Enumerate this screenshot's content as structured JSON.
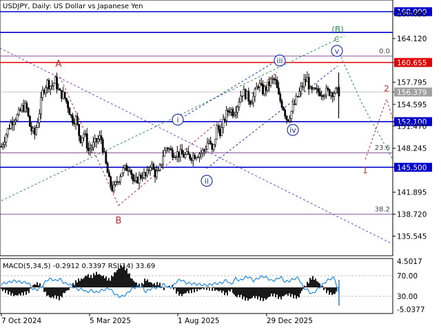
{
  "window_title": "USDJPY, Daily:  US Dollar vs Japanese Yen",
  "chart_data": [
    {
      "type": "candlestick",
      "symbol": "USDJPY",
      "timeframe": "Daily",
      "ylim": [
        133.8,
        170.0
      ],
      "xlim": [
        "2024-10-07",
        "2026-03-12"
      ],
      "y_ticks": [
        "168.000",
        "167.695",
        "164.120",
        "160.655",
        "157.795",
        "156.379",
        "154.595",
        "152.100",
        "151.470",
        "148.245",
        "145.500",
        "141.895",
        "138.720",
        "135.545"
      ],
      "x_ticks": [
        "7 Oct 2024",
        "5 Mar 2025",
        "1 Aug 2025",
        "29 Dec 2025"
      ],
      "close_path": [
        [
          "2024-10-07",
          148.5
        ],
        [
          "2024-10-14",
          150.1
        ],
        [
          "2024-10-21",
          151.6
        ],
        [
          "2024-10-28",
          152.6
        ],
        [
          "2024-11-04",
          152.9
        ],
        [
          "2024-11-11",
          154.1
        ],
        [
          "2024-11-18",
          154.3
        ],
        [
          "2024-11-25",
          151.1
        ],
        [
          "2024-12-02",
          150.2
        ],
        [
          "2024-12-09",
          152.9
        ],
        [
          "2024-12-16",
          156.5
        ],
        [
          "2024-12-23",
          157.8
        ],
        [
          "2024-12-30",
          157.2
        ],
        [
          "2025-01-06",
          158.0
        ],
        [
          "2025-01-13",
          156.2
        ],
        [
          "2025-01-20",
          155.9
        ],
        [
          "2025-01-27",
          154.6
        ],
        [
          "2025-02-03",
          152.4
        ],
        [
          "2025-02-10",
          152.5
        ],
        [
          "2025-02-17",
          149.5
        ],
        [
          "2025-02-24",
          150.5
        ],
        [
          "2025-03-03",
          147.9
        ],
        [
          "2025-03-10",
          148.6
        ],
        [
          "2025-03-17",
          149.3
        ],
        [
          "2025-03-24",
          149.9
        ],
        [
          "2025-03-31",
          146.6
        ],
        [
          "2025-04-07",
          143.5
        ],
        [
          "2025-04-14",
          142.2
        ],
        [
          "2025-04-21",
          143.6
        ],
        [
          "2025-04-28",
          144.9
        ],
        [
          "2025-05-05",
          145.3
        ],
        [
          "2025-05-12",
          145.7
        ],
        [
          "2025-05-19",
          142.9
        ],
        [
          "2025-05-26",
          143.9
        ],
        [
          "2025-06-02",
          144.5
        ],
        [
          "2025-06-09",
          144.1
        ],
        [
          "2025-06-16",
          146.1
        ],
        [
          "2025-06-23",
          144.6
        ],
        [
          "2025-06-30",
          144.6
        ],
        [
          "2025-07-07",
          147.3
        ],
        [
          "2025-07-14",
          148.6
        ],
        [
          "2025-07-21",
          147.7
        ],
        [
          "2025-07-28",
          147.6
        ],
        [
          "2025-08-04",
          147.4
        ],
        [
          "2025-08-11",
          147.2
        ],
        [
          "2025-08-18",
          147.1
        ],
        [
          "2025-08-25",
          147.1
        ],
        [
          "2025-09-01",
          147.4
        ],
        [
          "2025-09-08",
          147.6
        ],
        [
          "2025-09-15",
          147.9
        ],
        [
          "2025-09-22",
          149.5
        ],
        [
          "2025-09-29",
          147.5
        ],
        [
          "2025-10-06",
          151.2
        ],
        [
          "2025-10-13",
          150.6
        ],
        [
          "2025-10-20",
          152.8
        ],
        [
          "2025-10-27",
          154.0
        ],
        [
          "2025-11-03",
          153.4
        ],
        [
          "2025-11-10",
          154.6
        ],
        [
          "2025-11-17",
          156.4
        ],
        [
          "2025-11-24",
          156.1
        ],
        [
          "2025-12-01",
          155.1
        ],
        [
          "2025-12-08",
          155.8
        ],
        [
          "2025-12-15",
          157.7
        ],
        [
          "2025-12-22",
          156.5
        ],
        [
          "2025-12-29",
          157.0
        ],
        [
          "2026-01-05",
          157.9
        ],
        [
          "2026-01-12",
          158.2
        ],
        [
          "2026-01-19",
          155.5
        ],
        [
          "2026-01-26",
          154.3
        ],
        [
          "2026-02-02",
          152.3
        ],
        [
          "2026-02-09",
          153.6
        ],
        [
          "2026-02-16",
          155.0
        ],
        [
          "2026-02-23",
          156.4
        ],
        [
          "2026-03-02",
          157.8
        ],
        [
          "2026-03-09",
          158.3
        ],
        [
          "2026-03-12",
          156.4
        ]
      ],
      "levels": [
        {
          "label": "168.000",
          "value": 168.0,
          "color": "#0000cc",
          "width": 1.6
        },
        {
          "label": "165.000",
          "value": 165.0,
          "color": "#0000cc",
          "width": 1.6
        },
        {
          "label": "160.655",
          "value": 160.655,
          "color": "#e00000",
          "width": 1.6
        },
        {
          "label": "152.100",
          "value": 152.1,
          "color": "#0000cc",
          "width": 1.6
        },
        {
          "label": "145.500",
          "value": 145.5,
          "color": "#0000cc",
          "width": 1.6
        }
      ],
      "fib_lines": [
        {
          "label": "0.0",
          "value": 161.6
        },
        {
          "label": "23.6",
          "value": 147.6
        },
        {
          "label": "38.2",
          "value": 138.72
        }
      ],
      "current_price": "156.379",
      "current_price_value": 156.379,
      "wave_labels": [
        "A",
        "B",
        "C",
        "(B)",
        "i",
        "ii",
        "iii",
        "iv",
        "v",
        "1",
        "2"
      ],
      "colors": {
        "up": "#000000",
        "levels_blue": "#0000cc",
        "level_red": "#e00000",
        "fib": "#6b2c7e",
        "green": "#2e8b57",
        "dark_red": "#8b1a1a",
        "purple": "#7a3db8"
      }
    },
    {
      "type": "line",
      "title": "MACD(5,34,5) -0.2912 0.3397 RSI(14) 33.69",
      "y_ticks": [
        "4.5017",
        "70.00",
        "30.00",
        "-5.0377"
      ],
      "ylim": [
        -5.0377,
        4.5017
      ],
      "rsi_levels": [
        70,
        30
      ],
      "series": [
        {
          "name": "RSI(14)",
          "color": "#1e88e5",
          "values": [
            54,
            56,
            58,
            60,
            58,
            57,
            56,
            44,
            43,
            48,
            61,
            64,
            60,
            64,
            55,
            54,
            48,
            43,
            44,
            38,
            42,
            37,
            41,
            43,
            46,
            36,
            30,
            30,
            36,
            45,
            48,
            52,
            38,
            44,
            47,
            46,
            54,
            47,
            48,
            60,
            62,
            56,
            55,
            54,
            53,
            52,
            52,
            54,
            55,
            56,
            62,
            52,
            65,
            60,
            66,
            68,
            60,
            65,
            69,
            66,
            60,
            62,
            68,
            58,
            60,
            64,
            66,
            48,
            42,
            34,
            42,
            50,
            58,
            64,
            66,
            34
          ]
        },
        {
          "name": "MACD",
          "color": "#000000",
          "values": [
            0.4,
            0.8,
            1.2,
            1.6,
            1.4,
            1.2,
            1.0,
            -0.4,
            -0.8,
            -0.2,
            1.4,
            2.0,
            1.8,
            2.2,
            1.0,
            0.4,
            -0.6,
            -1.4,
            -1.6,
            -2.4,
            -2.0,
            -2.8,
            -2.4,
            -2.0,
            -1.4,
            -2.6,
            -3.6,
            -4.2,
            -3.2,
            -1.6,
            -0.8,
            -0.2,
            -1.6,
            -1.0,
            -0.6,
            -0.8,
            0.4,
            -0.2,
            -0.2,
            1.0,
            1.6,
            1.0,
            0.8,
            0.6,
            0.4,
            0.2,
            0.2,
            0.4,
            0.6,
            0.8,
            1.4,
            0.4,
            1.8,
            1.6,
            2.2,
            2.4,
            1.8,
            2.0,
            2.4,
            2.2,
            1.4,
            1.6,
            2.2,
            1.4,
            1.4,
            1.8,
            2.0,
            0.2,
            -0.8,
            -2.0,
            -1.4,
            -0.4,
            0.6,
            1.2,
            1.4,
            -0.2912
          ]
        }
      ]
    }
  ]
}
